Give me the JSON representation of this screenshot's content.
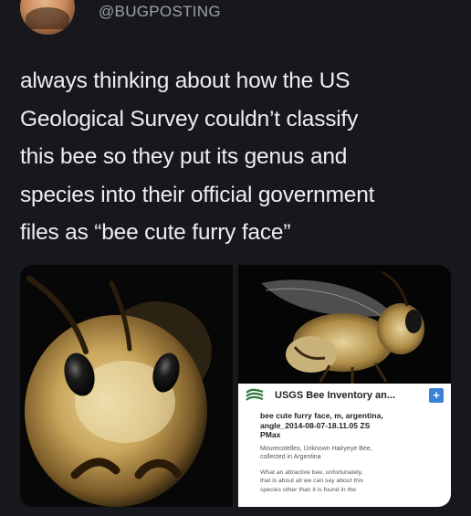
{
  "tweet": {
    "handle": "@BUGPOSTING",
    "text": "always thinking about how the US\nGeological Survey couldn’t classify\nthis bee so they put its genus and\nspecies into their official government\nfiles as “bee cute furry face”"
  },
  "card": {
    "title": "USGS Bee Inventory an...",
    "plus_label": "+",
    "main_text": "bee cute furry face, m, argentina,\nangle_2014-08-07-18.11.05 ZS\nPMax",
    "sub_text": "Mourecotelles, Unknown Hairyeye Bee,\ncollected in Argentina",
    "description": "What an attractive bee, unfortunately,\nthat is about all we can say about this\nspecies other than it is found in the"
  },
  "colors": {
    "background": "#16181d",
    "text": "#eceef0",
    "handle": "#9ea1a8",
    "plus_button": "#3b82d6"
  }
}
